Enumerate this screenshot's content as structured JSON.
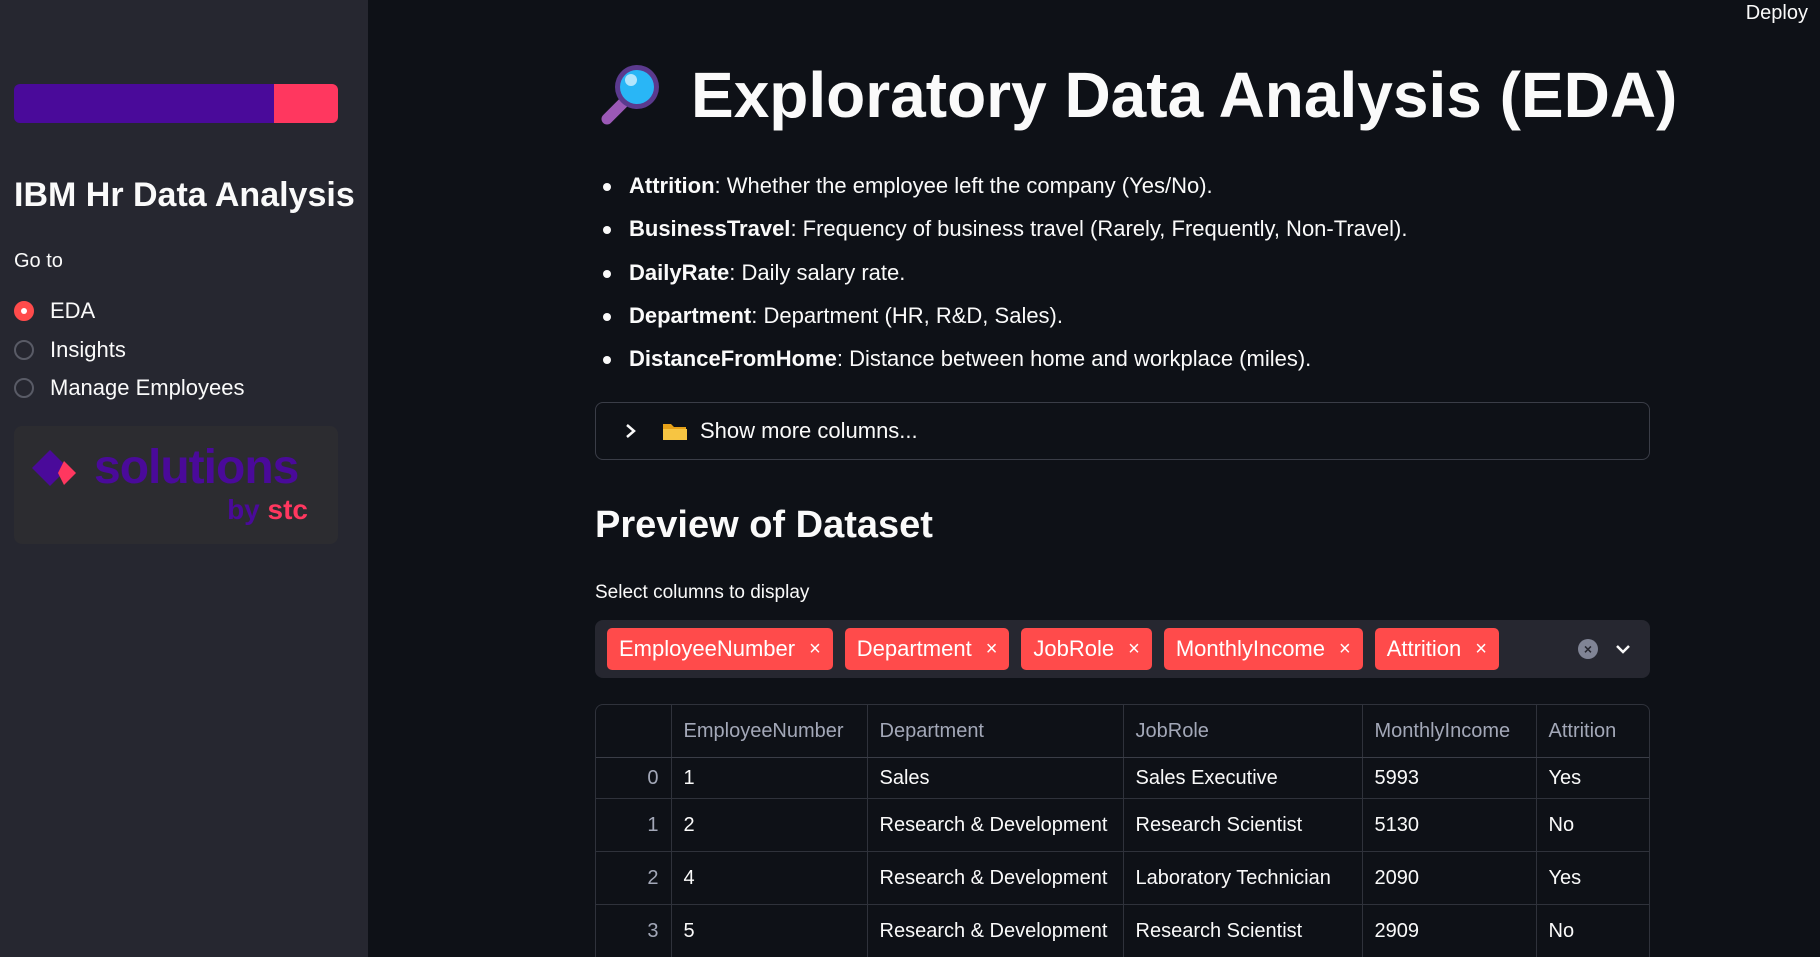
{
  "header": {
    "deploy_label": "Deploy"
  },
  "sidebar": {
    "title": "IBM Hr Data Analysis",
    "goto_label": "Go to",
    "nav": [
      {
        "label": "EDA",
        "selected": true
      },
      {
        "label": "Insights",
        "selected": false
      },
      {
        "label": "Manage Employees",
        "selected": false
      }
    ],
    "logo": {
      "word": "solutions",
      "by": "by",
      "brand": "stc"
    },
    "colors": {
      "purple": "#4a0a9a",
      "pink": "#ff375f"
    }
  },
  "main": {
    "title": "Exploratory Data Analysis (EDA)",
    "title_icon": "magnifying-glass-icon",
    "bullets": [
      {
        "term": "Attrition",
        "desc": ": Whether the employee left the company (Yes/No)."
      },
      {
        "term": "BusinessTravel",
        "desc": ": Frequency of business travel (Rarely, Frequently, Non-Travel)."
      },
      {
        "term": "DailyRate",
        "desc": ": Daily salary rate."
      },
      {
        "term": "Department",
        "desc": ": Department (HR, R&D, Sales)."
      },
      {
        "term": "DistanceFromHome",
        "desc": ": Distance between home and workplace (miles)."
      }
    ],
    "expander": {
      "label": "Show more columns...",
      "icon": "folder-icon"
    },
    "preview_title": "Preview of Dataset",
    "multiselect": {
      "label": "Select columns to display",
      "selected": [
        "EmployeeNumber",
        "Department",
        "JobRole",
        "MonthlyIncome",
        "Attrition"
      ],
      "remove_glyph": "×",
      "clear_glyph": "×"
    },
    "table": {
      "columns": [
        "",
        "EmployeeNumber",
        "Department",
        "JobRole",
        "MonthlyIncome",
        "Attrition"
      ],
      "rows": [
        [
          "0",
          "1",
          "Sales",
          "Sales Executive",
          "5993",
          "Yes"
        ],
        [
          "1",
          "2",
          "Research & Development",
          "Research Scientist",
          "5130",
          "No"
        ],
        [
          "2",
          "4",
          "Research & Development",
          "Laboratory Technician",
          "2090",
          "Yes"
        ],
        [
          "3",
          "5",
          "Research & Development",
          "Research Scientist",
          "2909",
          "No"
        ]
      ]
    },
    "accent_color": "#ff4b4b"
  }
}
